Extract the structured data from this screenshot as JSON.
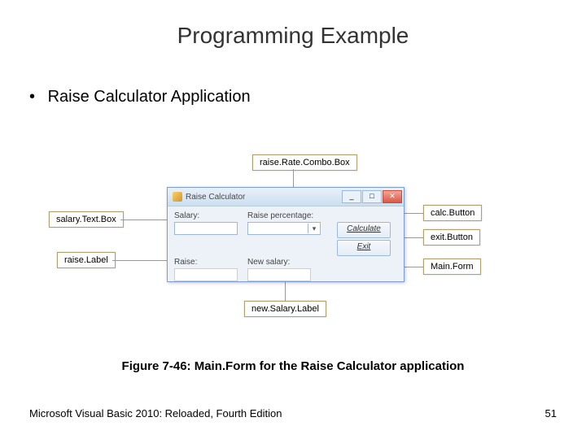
{
  "title": "Programming Example",
  "bullet": "Raise Calculator Application",
  "caption": "Figure 7-46: Main.Form for the Raise Calculator application",
  "footer": {
    "text": "Microsoft Visual Basic 2010: Reloaded, Fourth Edition",
    "page": "51"
  },
  "form": {
    "windowTitle": "Raise Calculator",
    "labels": {
      "salary": "Salary:",
      "raisePct": "Raise percentage:",
      "raise": "Raise:",
      "newSalary": "New salary:"
    },
    "buttons": {
      "calculate": "Calculate",
      "exit": "Exit"
    },
    "winbtns": {
      "min": "_",
      "max": "□",
      "close": "✕"
    },
    "comboArrow": "▾"
  },
  "callouts": {
    "raiseRateCombo": "raise.Rate.Combo.Box",
    "salaryTextBox": "salary.Text.Box",
    "raiseLabel": "raise.Label",
    "calcButton": "calc.Button",
    "exitButton": "exit.Button",
    "mainForm": "Main.Form",
    "newSalaryLabel": "new.Salary.Label"
  }
}
